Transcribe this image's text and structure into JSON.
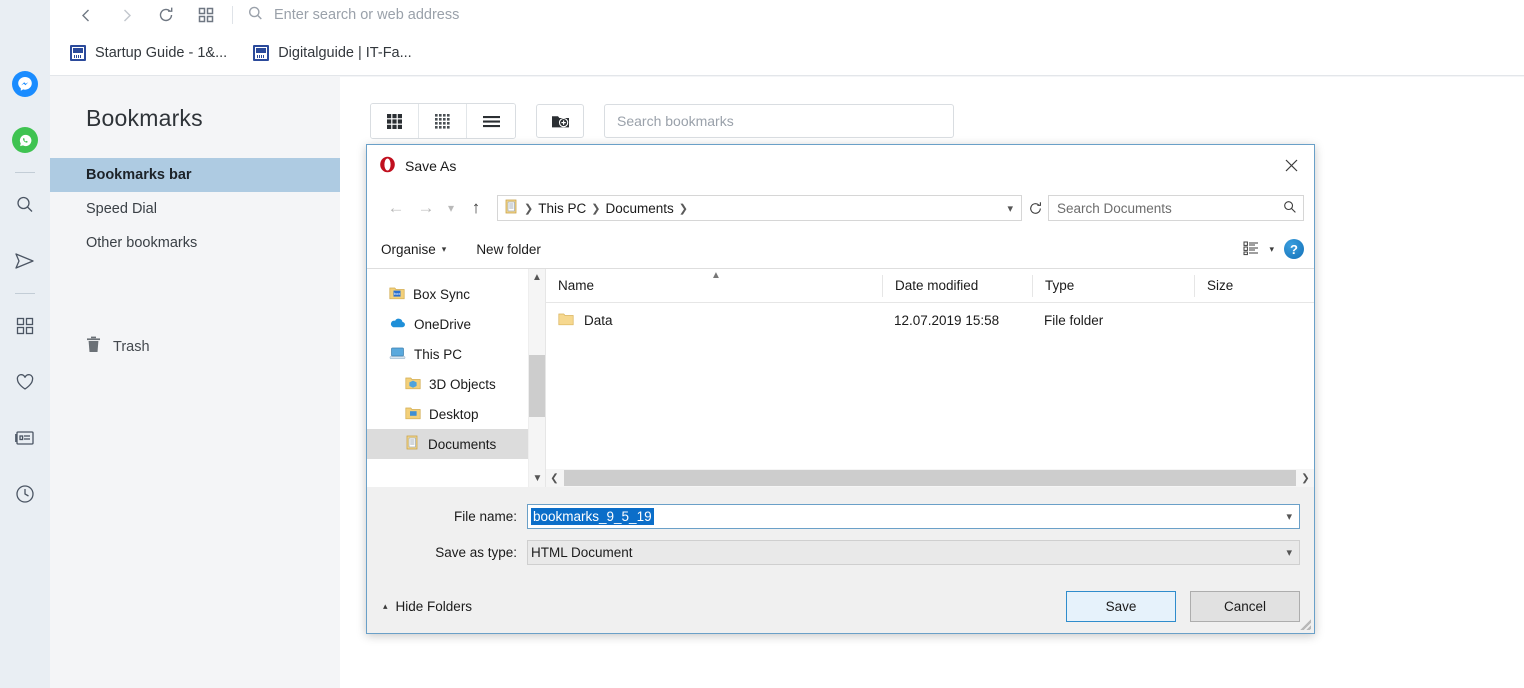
{
  "browser": {
    "address_placeholder": "Enter search or web address",
    "nav": {
      "back_icon": "chevron-left-icon",
      "forward_icon": "chevron-right-icon",
      "reload_icon": "reload-icon",
      "speeddial_icon": "grid-icon",
      "search_icon": "search-icon"
    },
    "bookmarks_bar": [
      {
        "label": "Startup Guide - 1&...",
        "icon": "site-favicon"
      },
      {
        "label": "Digitalguide | IT-Fa...",
        "icon": "site-favicon"
      }
    ],
    "sidebar_rail": [
      {
        "name": "messenger-icon",
        "color": "#1a8cff"
      },
      {
        "name": "whatsapp-icon",
        "color": "#3fc351"
      },
      {
        "name": "search-icon",
        "color": "#4b5563"
      },
      {
        "name": "send-icon",
        "color": "#4b5563"
      },
      {
        "name": "speed-dial-icon",
        "color": "#4b5563"
      },
      {
        "name": "heart-icon",
        "color": "#4b5563"
      },
      {
        "name": "news-icon",
        "color": "#4b5563"
      },
      {
        "name": "history-clock-icon",
        "color": "#4b5563"
      }
    ]
  },
  "bookmarks_page": {
    "title": "Bookmarks",
    "nav_items": [
      {
        "label": "Bookmarks bar",
        "active": true
      },
      {
        "label": "Speed Dial",
        "active": false
      },
      {
        "label": "Other bookmarks",
        "active": false
      }
    ],
    "trash_label": "Trash",
    "trash_icon": "trash-icon",
    "toolbar": {
      "view_large_grid": "grid-large-icon",
      "view_small_grid": "grid-small-icon",
      "view_list": "list-icon",
      "new_folder": "new-folder-icon",
      "search_placeholder": "Search bookmarks"
    }
  },
  "dialog": {
    "title": "Save As",
    "app_icon": "opera-logo-icon",
    "close_icon": "close-icon",
    "nav": {
      "back_icon": "arrow-left-icon",
      "forward_icon": "arrow-right-icon",
      "recent_icon": "chevron-down-icon",
      "up_icon": "arrow-up-icon",
      "path_icon": "documents-folder-icon",
      "refresh_icon": "refresh-icon",
      "dropdown_icon": "chevron-down-icon"
    },
    "breadcrumbs": [
      "This PC",
      "Documents"
    ],
    "search_placeholder": "Search Documents",
    "search_icon": "magnifier-icon",
    "toolbar": {
      "organise_label": "Organise",
      "new_folder_label": "New folder",
      "view_icon": "view-options-icon",
      "view_caret": "chevron-down-icon",
      "help_label": "?",
      "help_icon": "help-icon"
    },
    "tree": [
      {
        "label": "Box Sync",
        "icon": "box-sync-folder-icon",
        "level": 0,
        "selected": false
      },
      {
        "label": "OneDrive",
        "icon": "onedrive-cloud-icon",
        "level": 0,
        "selected": false
      },
      {
        "label": "This PC",
        "icon": "this-pc-icon",
        "level": 0,
        "selected": false
      },
      {
        "label": "3D Objects",
        "icon": "3d-objects-folder-icon",
        "level": 1,
        "selected": false
      },
      {
        "label": "Desktop",
        "icon": "desktop-folder-icon",
        "level": 1,
        "selected": false
      },
      {
        "label": "Documents",
        "icon": "documents-folder-icon",
        "level": 1,
        "selected": true
      }
    ],
    "columns": [
      "Name",
      "Date modified",
      "Type",
      "Size"
    ],
    "files": [
      {
        "name": "Data",
        "date_modified": "12.07.2019 15:58",
        "type": "File folder",
        "size": "",
        "icon": "folder-icon"
      }
    ],
    "fields": {
      "file_name_label": "File name:",
      "file_name_value": "bookmarks_9_5_19",
      "save_as_type_label": "Save as type:",
      "save_as_type_value": "HTML Document"
    },
    "footer": {
      "hide_folders_label": "Hide Folders",
      "hide_folders_icon": "chevron-up-icon",
      "save_label": "Save",
      "cancel_label": "Cancel"
    },
    "accent_color": "#2f8ccc",
    "selection_color": "#0b6ec9"
  }
}
